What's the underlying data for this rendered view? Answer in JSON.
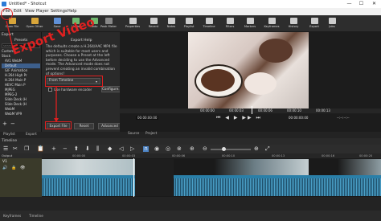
{
  "window": {
    "title": "Untitled* - Shotcut",
    "minimize": "—",
    "maximize": "☐",
    "close": "✕"
  },
  "menu": [
    "File",
    "Edit",
    "View",
    "Player",
    "Settings",
    "Help"
  ],
  "toolbar": {
    "left": [
      "Open File",
      "Open Other",
      "Save",
      "Undo",
      "Redo"
    ],
    "right": [
      "Peak Meter",
      "Properties",
      "Recent",
      "Notes",
      "Playlist",
      "Timeline",
      "Filters",
      "Markers",
      "Keyframes",
      "History",
      "Export",
      "Jobs"
    ]
  },
  "export": {
    "header": "Export",
    "presets_label": "Presets",
    "search_placeholder": "search",
    "presets": [
      "Custom",
      "Stock",
      "AV1 WebM",
      "Default",
      "GIF Animation",
      "H.264 High Pr",
      "H.264 Main P",
      "HEVC Main P",
      "MJPEG",
      "MPEG-2",
      "Slide Deck (H",
      "Slide Deck (H",
      "WebM",
      "WebM VP9"
    ],
    "help_title": "Export Help",
    "help_text": "The defaults create a H.264/AAC MP4 file which is suitable for most users and purposes. Choose a Preset at the left before deciding to use the Advanced mode. The Advanced mode does not prevent creating an invalid combination of options!",
    "from_label": "From",
    "from_value": "From Timeline",
    "hw_encoder": "Use hardware encoder",
    "configure": "Configure...",
    "buttons": [
      "Export File",
      "Reset",
      "Advanced"
    ]
  },
  "annotation": {
    "text": "Export Video"
  },
  "player": {
    "timecode_left": "00:00:00:00",
    "ruler": [
      "00:00:00",
      "00:00:03",
      "00:00:06",
      "00:00:10",
      "00:00:13"
    ],
    "timecode_right": "00:00:00:00",
    "in_out": "--:--:--:--",
    "tabs": [
      "Source",
      "Project"
    ]
  },
  "left_tabs": [
    "Playlist",
    "Export"
  ],
  "timeline": {
    "header": "Timeline",
    "track_label": "Output",
    "track_name": "V1",
    "ruler": [
      "00:00:00",
      "00:00:03",
      "00:00:06",
      "00:00:10",
      "00:00:13",
      "00:00:16",
      "00:00:20"
    ],
    "zoom": "1x"
  },
  "bottom_tabs": [
    "Keyframes",
    "Timeline"
  ]
}
